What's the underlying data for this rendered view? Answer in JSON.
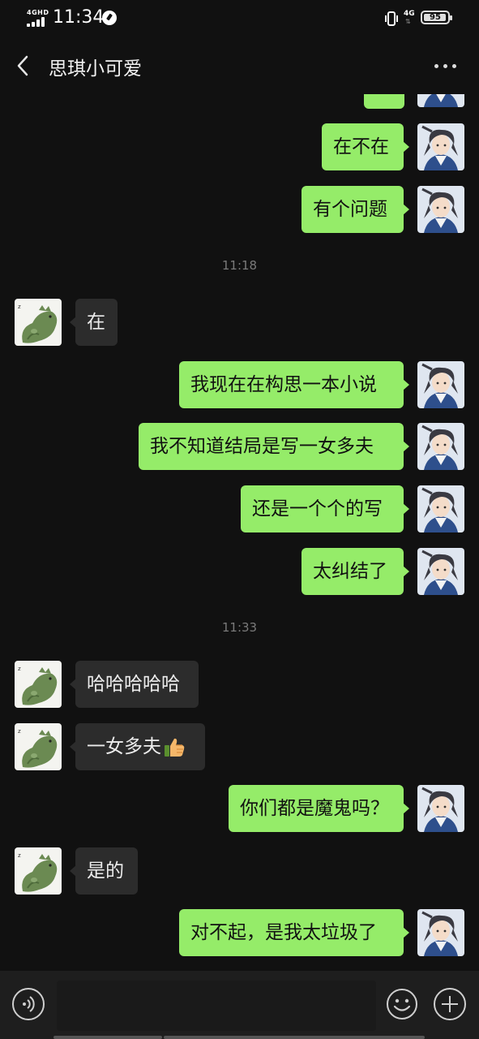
{
  "status_bar": {
    "network_label": "4GHD",
    "time": "11:34",
    "network_right": "4G",
    "battery": "95",
    "battery_level": 0.95
  },
  "header": {
    "title": "思琪小可爱",
    "back_icon": "chevron-left-icon",
    "more_icon": "more-dots-icon"
  },
  "colors": {
    "background": "#111111",
    "outgoing_bubble": "#95ec69",
    "incoming_bubble": "#2c2c2c",
    "input_bar": "#1e1e1e"
  },
  "messages": [
    {
      "side": "out",
      "text": "在不在"
    },
    {
      "side": "out",
      "text": "有个问题"
    },
    {
      "time": "11:18"
    },
    {
      "side": "in",
      "text": "在"
    },
    {
      "side": "out",
      "text": "我现在在构思一本小说"
    },
    {
      "side": "out",
      "text": "我不知道结局是写一女多夫"
    },
    {
      "side": "out",
      "text": "还是一个个的写"
    },
    {
      "side": "out",
      "text": "太纠结了"
    },
    {
      "time": "11:33"
    },
    {
      "side": "in",
      "text": "哈哈哈哈哈"
    },
    {
      "side": "in",
      "text": "一女多夫",
      "emoji": "thumbs-up-icon"
    },
    {
      "side": "out",
      "text": "你们都是魔鬼吗？"
    },
    {
      "side": "in",
      "text": "是的"
    },
    {
      "side": "out",
      "text": "对不起，是我太垃圾了"
    }
  ],
  "input_bar": {
    "voice_icon": "voice-icon",
    "input_value": "",
    "emoji_icon": "emoji-icon",
    "plus_icon": "plus-icon"
  }
}
